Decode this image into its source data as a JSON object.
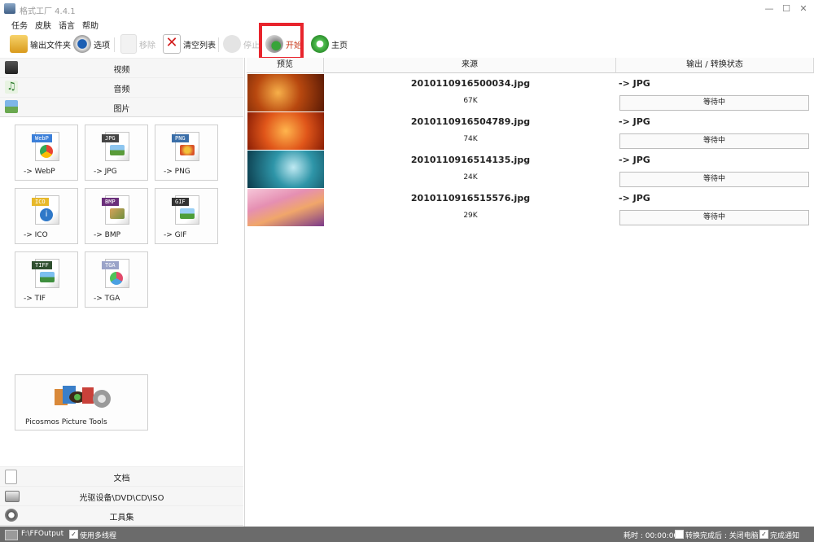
{
  "window": {
    "title": "格式工厂 4.4.1",
    "minimize": "—",
    "maximize": "☐",
    "close": "✕"
  },
  "menu": [
    "任务",
    "皮肤",
    "语言",
    "帮助"
  ],
  "toolbar": {
    "output_folder": "输出文件夹",
    "options": "选项",
    "remove": "移除",
    "clear_list": "清空列表",
    "stop": "停止",
    "start": "开始",
    "home": "主页"
  },
  "sidebar": {
    "video": "视频",
    "audio": "音频",
    "image": "图片",
    "document": "文档",
    "optical": "光驱设备\\DVD\\CD\\ISO",
    "tools": "工具集",
    "tiles": [
      {
        "label": "-> WebP",
        "tag": "WebP",
        "color": "#3b7fd9"
      },
      {
        "label": "-> JPG",
        "tag": "JPG",
        "color": "#444444"
      },
      {
        "label": "-> PNG",
        "tag": "PNG",
        "color": "#3a6ea8"
      },
      {
        "label": "-> ICO",
        "tag": "ICO",
        "color": "#e7b82a"
      },
      {
        "label": "-> BMP",
        "tag": "BMP",
        "color": "#6a2f7a"
      },
      {
        "label": "-> GIF",
        "tag": "GIF",
        "color": "#333333"
      },
      {
        "label": "-> TIF",
        "tag": "TIFF",
        "color": "#2f4f2f"
      },
      {
        "label": "-> TGA",
        "tag": "TGA",
        "color": "#9aa3c8"
      }
    ],
    "picosmos": "Picosmos Picture Tools"
  },
  "list": {
    "headers": {
      "preview": "预览",
      "source": "来源",
      "output": "输出 / 转换状态"
    },
    "rows": [
      {
        "file": "2010110916500034.jpg",
        "size": "67K",
        "format": "-> JPG",
        "status": "等待中"
      },
      {
        "file": "2010110916504789.jpg",
        "size": "74K",
        "format": "-> JPG",
        "status": "等待中"
      },
      {
        "file": "2010110916514135.jpg",
        "size": "24K",
        "format": "-> JPG",
        "status": "等待中"
      },
      {
        "file": "2010110916515576.jpg",
        "size": "29K",
        "format": "-> JPG",
        "status": "等待中"
      }
    ]
  },
  "status": {
    "path": "F:\\FFOutput",
    "multithread": "使用多线程",
    "elapsed": "耗时 : 00:00:00",
    "after_done": "转换完成后 : 关闭电脑",
    "notify": "完成通知"
  }
}
